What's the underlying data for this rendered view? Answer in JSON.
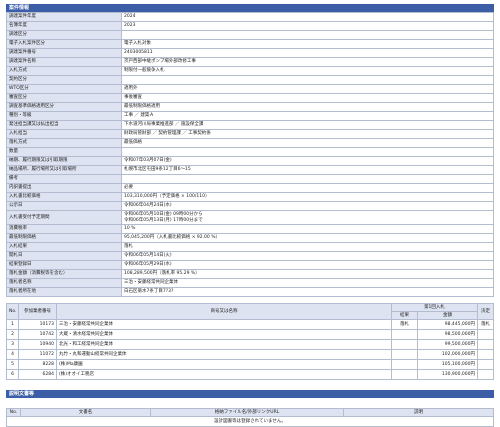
{
  "case_info": {
    "header": "案件情報",
    "rows": [
      {
        "label": "調達案件年度",
        "value": "2024"
      },
      {
        "label": "名簿年度",
        "value": "2023"
      },
      {
        "label": "調達区分",
        "value": ""
      },
      {
        "label": "電子入札案件区分",
        "value": "電子入札対象"
      },
      {
        "label": "調達案件番号",
        "value": "2403005811"
      },
      {
        "label": "調達案件名称",
        "value": "茨戸西部中継ポンプ場外部改修工事"
      },
      {
        "label": "入札方式",
        "value": "制限付一般競争入札"
      },
      {
        "label": "契約区分",
        "value": ""
      },
      {
        "label": "WTO区分",
        "value": "適用外"
      },
      {
        "label": "審査区分",
        "value": "事後審査"
      },
      {
        "label": "調査基準価格適用区分",
        "value": "最低制限価格適用"
      },
      {
        "label": "種別・等級",
        "value": "工事 ／ 建築Ａ"
      },
      {
        "label": "発注担当課又は払出担当",
        "value": "下水道河川局事業推進部 ／ 施設保全課"
      },
      {
        "label": "入札担当",
        "value": "財政局管財部 ／ 契約管理課 ／ 工事契約係"
      },
      {
        "label": "落札方式",
        "value": "最低価格"
      },
      {
        "label": "数量",
        "value": ""
      },
      {
        "label": "納期、履行期限又は引取期限",
        "value": "令和07年03月07日(金)"
      },
      {
        "label": "納品場所、履行場所又は引取場所",
        "value": "札幌市北区屯田9条12丁目6～15"
      },
      {
        "label": "備考",
        "value": ""
      },
      {
        "label": "内訳書提出",
        "value": "必要"
      },
      {
        "label": "入札書比較価格",
        "value": "103,310,000円（予定価格 × 100/110）"
      },
      {
        "label": "公示日",
        "value": "令和06年04月24日(水)"
      },
      {
        "label": "入札書受付予定期間",
        "value": "令和06年05月10日(金) 09時00分から",
        "value2": "令和06年05月13日(月) 17時00分まで"
      },
      {
        "label": "消費税率",
        "value": "10 %"
      },
      {
        "label": "最低制限価格",
        "value": "95,045,200円（入札書比較価格 × 92.00 %）"
      },
      {
        "label": "入札結果",
        "value": "落札"
      },
      {
        "label": "開札日",
        "value": "令和06年05月14日(火)"
      },
      {
        "label": "結果登録日",
        "value": "令和06年05月29日(水)"
      },
      {
        "label": "落札金額（消費税等を含む）",
        "value": "108,289,500円（落札率 95.29 %）"
      },
      {
        "label": "落札者名称",
        "value": "三治・安藤経常共同企業体"
      },
      {
        "label": "落札者所在地",
        "value": "白石区菊水7条丁目7?3?"
      }
    ]
  },
  "bids": {
    "headers": {
      "no": "No.",
      "bidder_no": "参加業者番号",
      "name": "商号又は名称",
      "round": "第1回入札",
      "result": "結果",
      "amount": "金額",
      "decision": "決定"
    },
    "rows": [
      {
        "no": "1",
        "bidder_no": "10173",
        "name": "三治・安藤経常共同企業体",
        "result": "落札",
        "amount": "98,445,000円",
        "decision": "落札"
      },
      {
        "no": "2",
        "bidder_no": "10742",
        "name": "大蔵・清水経常共同企業体",
        "result": "",
        "amount": "98,500,000円",
        "decision": ""
      },
      {
        "no": "3",
        "bidder_no": "10940",
        "name": "北光・和工経常共同企業体",
        "result": "",
        "amount": "99,500,000円",
        "decision": ""
      },
      {
        "no": "4",
        "bidder_no": "11072",
        "name": "丸竹・丸和運動山経常共同企業体",
        "result": "",
        "amount": "102,000,000円",
        "decision": ""
      },
      {
        "no": "5",
        "bidder_no": "8228",
        "name": "(株)Ma康園",
        "result": "",
        "amount": "105,100,000円",
        "decision": ""
      },
      {
        "no": "6",
        "bidder_no": "6284",
        "name": "(株)オオイ工務店",
        "result": "",
        "amount": "130,900,000円",
        "decision": ""
      }
    ]
  },
  "docs": {
    "header": "説明文書等",
    "columns": {
      "no": "No.",
      "doc_name": "文書名",
      "file_link": "格納ファイル名/外部リンクURL",
      "description": "説明"
    },
    "empty_message": "設計図書等は登録されていません。"
  }
}
